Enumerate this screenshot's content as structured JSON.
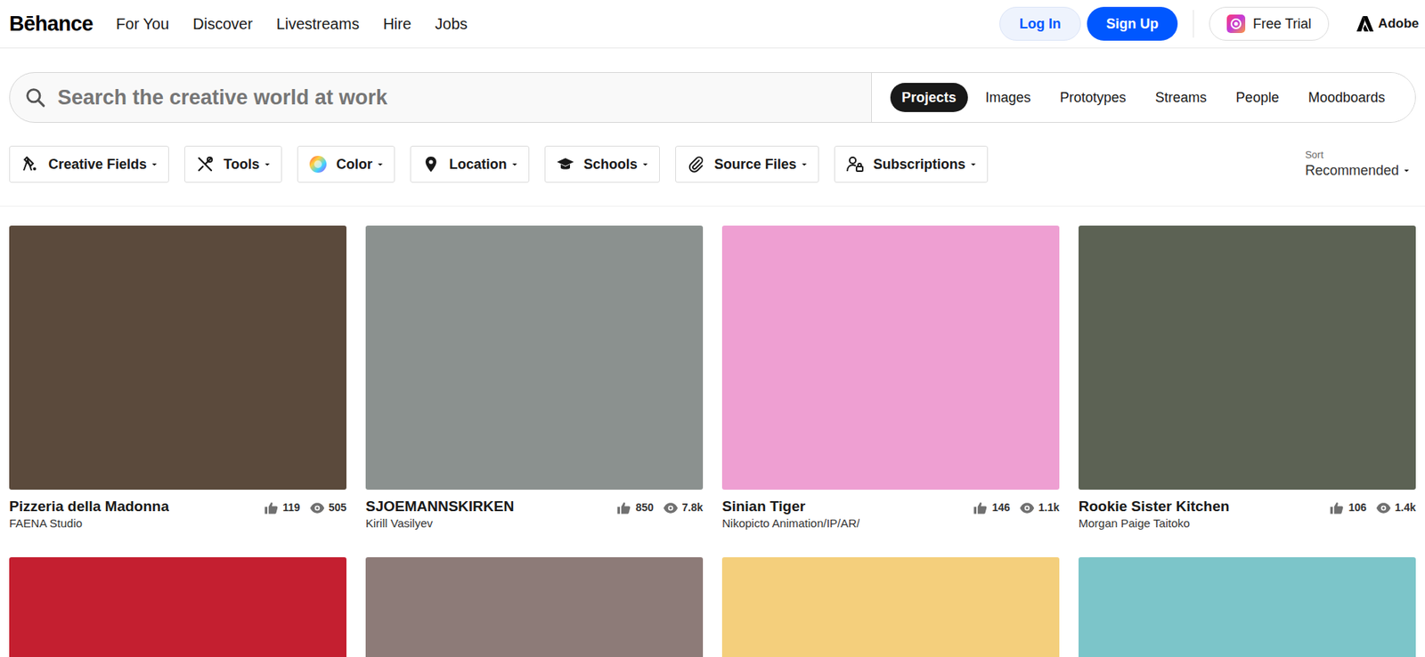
{
  "header": {
    "logo": "Bēhance",
    "nav": [
      "For You",
      "Discover",
      "Livestreams",
      "Hire",
      "Jobs"
    ],
    "login": "Log In",
    "signup": "Sign Up",
    "trial": "Free Trial",
    "adobe": "Adobe"
  },
  "search": {
    "placeholder": "Search the creative world at work"
  },
  "tabs": [
    {
      "label": "Projects",
      "selected": true
    },
    {
      "label": "Images",
      "selected": false
    },
    {
      "label": "Prototypes",
      "selected": false
    },
    {
      "label": "Streams",
      "selected": false
    },
    {
      "label": "People",
      "selected": false
    },
    {
      "label": "Moodboards",
      "selected": false
    }
  ],
  "filters": [
    {
      "label": "Creative Fields",
      "kind": "fields"
    },
    {
      "label": "Tools",
      "kind": "tools"
    },
    {
      "label": "Color",
      "kind": "color"
    },
    {
      "label": "Location",
      "kind": "location"
    },
    {
      "label": "Schools",
      "kind": "schools"
    },
    {
      "label": "Source Files",
      "kind": "files"
    },
    {
      "label": "Subscriptions",
      "kind": "subscriptions"
    }
  ],
  "sort": {
    "label": "Sort",
    "value": "Recommended"
  },
  "projects": [
    {
      "title": "Pizzeria della Madonna",
      "author": "FAENA Studio",
      "likes": "119",
      "views": "505",
      "color": "#5b4a3c"
    },
    {
      "title": "SJOEMANNSKIRKEN",
      "author": "Kirill Vasilyev",
      "likes": "850",
      "views": "7.8k",
      "color": "#8b918f"
    },
    {
      "title": "Sinian Tiger",
      "author": "Nikopicto Animation/IP/AR/",
      "likes": "146",
      "views": "1.1k",
      "color": "#ee9fd2"
    },
    {
      "title": "Rookie Sister Kitchen",
      "author": "Morgan Paige Taitoko",
      "likes": "106",
      "views": "1.4k",
      "color": "#5c6254"
    }
  ],
  "more_projects": [
    {
      "color": "#c41f30"
    },
    {
      "color": "#8d7b78"
    },
    {
      "color": "#f4cf7c"
    },
    {
      "color": "#7cc5c9"
    }
  ]
}
